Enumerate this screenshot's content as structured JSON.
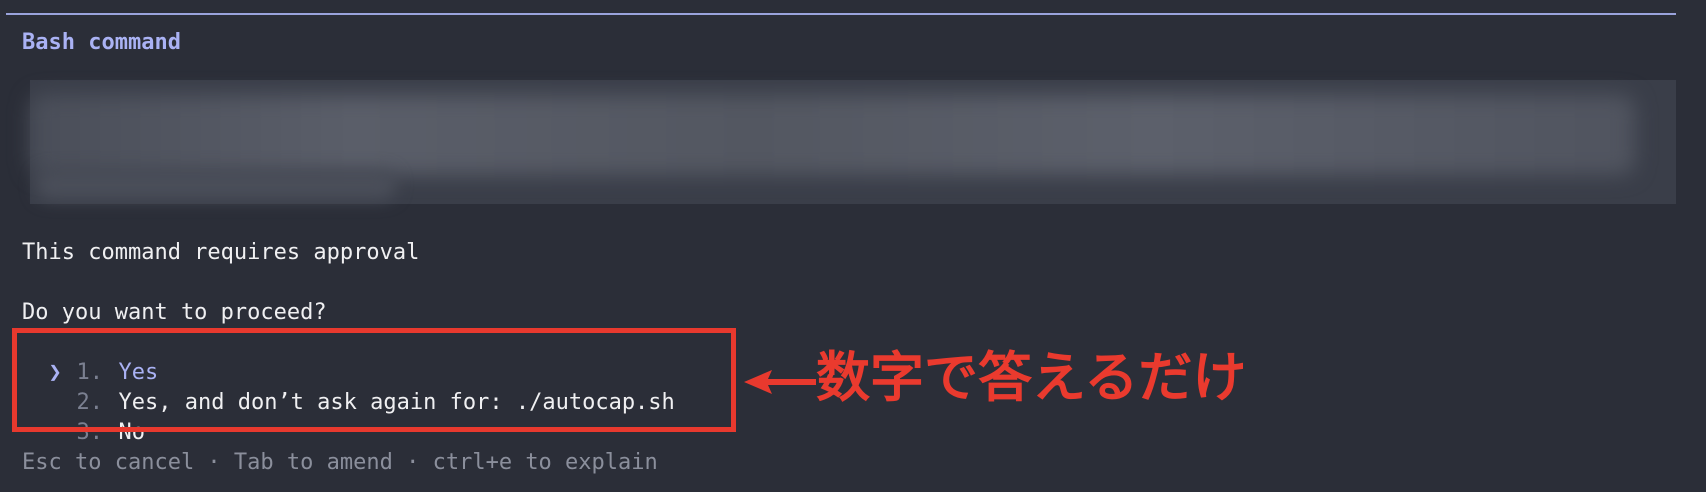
{
  "dialog": {
    "title": "Bash command",
    "command_redacted": true,
    "message": "This command requires approval",
    "question": "Do you want to proceed?",
    "pointer_icon": "chevron-right-icon",
    "options": [
      {
        "number": "1.",
        "label": "Yes",
        "selected": true
      },
      {
        "number": "2.",
        "label": "Yes, and don’t ask again for: ./autocap.sh",
        "selected": false
      },
      {
        "number": "3.",
        "label": "No",
        "selected": false
      }
    ],
    "footer": "Esc to cancel · Tab to amend · ctrl+e to explain"
  },
  "annotation": {
    "text": "数字で答えるだけ",
    "color": "#e8392e",
    "arrow_icon": "arrow-left-icon"
  },
  "colors": {
    "background": "#2b2e38",
    "accent": "#aab2f4",
    "text": "#f0f0f2",
    "muted": "#8b8f9c"
  }
}
